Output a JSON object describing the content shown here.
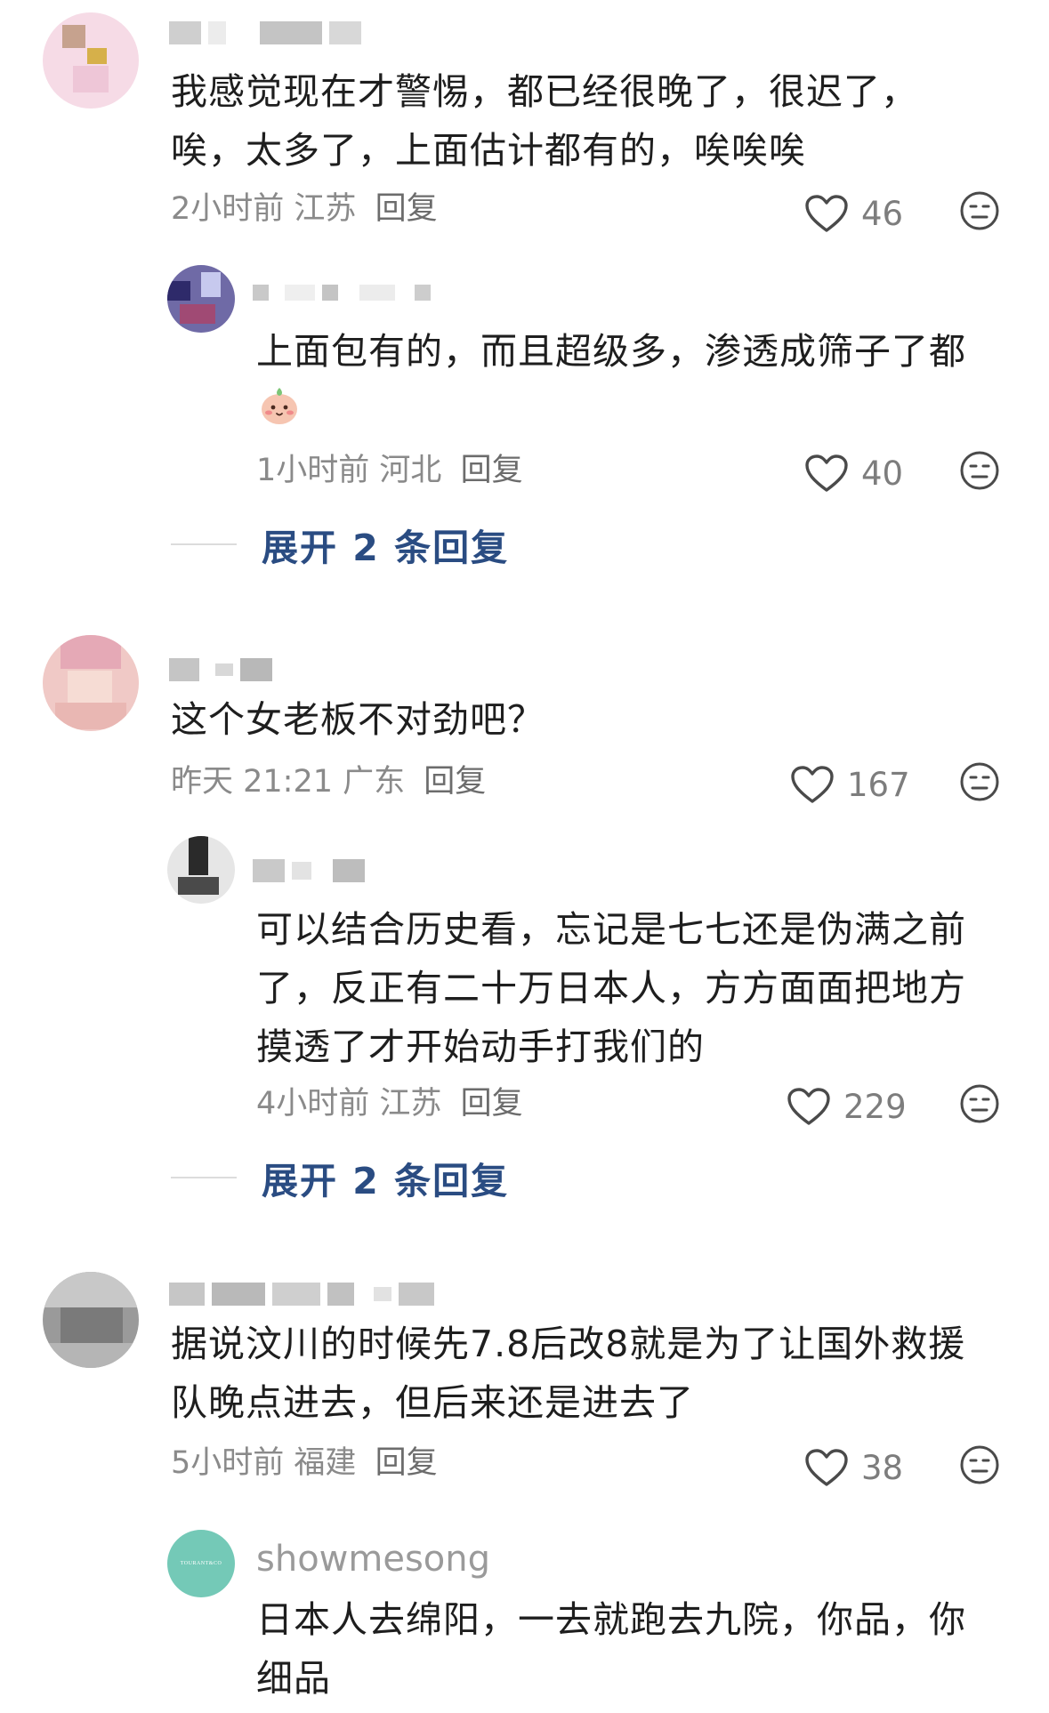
{
  "comments": [
    {
      "text_lines": [
        "我感觉现在才警惕，都已经很晚了，很迟了，",
        "唉，太多了，上面估计都有的，唉唉唉"
      ],
      "time": "2小时前",
      "location": "江苏",
      "reply": "回复",
      "likes": "46",
      "sub": {
        "text_line1": "上面包有的，而且超级多，渗透成筛子了都",
        "time": "1小时前",
        "location": "河北",
        "reply": "回复",
        "likes": "40"
      },
      "expand": "展开 2 条回复"
    },
    {
      "text_lines": [
        "这个女老板不对劲吧？"
      ],
      "time": "昨天 21:21",
      "location": "广东",
      "reply": "回复",
      "likes": "167",
      "sub": {
        "text_lines": [
          "可以结合历史看，忘记是七七还是伪满之前",
          "了，反正有二十万日本人，方方面面把地方",
          "摸透了才开始动手打我们的"
        ],
        "time": "4小时前",
        "location": "江苏",
        "reply": "回复",
        "likes": "229"
      },
      "expand": "展开 2 条回复"
    },
    {
      "text_lines": [
        "据说汶川的时候先7.8后改8就是为了让国外救援",
        "队晚点进去，但后来还是进去了"
      ],
      "time": "5小时前",
      "location": "福建",
      "reply": "回复",
      "likes": "38",
      "sub": {
        "username": "showmesong",
        "avatar_text": "TOURANT&CO",
        "text_lines": [
          "日本人去绵阳，一去就跑去九院，你品，你",
          "细品"
        ]
      }
    }
  ],
  "colors": {
    "link": "#2a4c82",
    "meta": "#8a8a8a",
    "text": "#1e1e1e"
  }
}
